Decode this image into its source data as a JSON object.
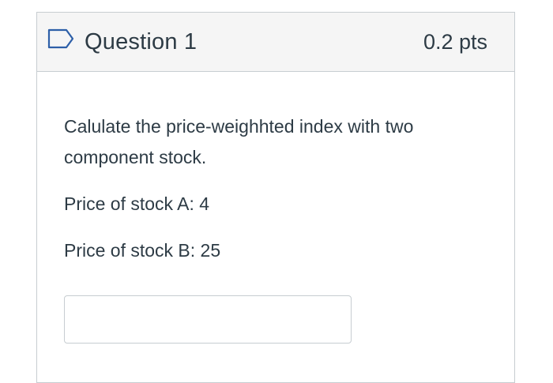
{
  "question": {
    "title": "Question 1",
    "points": "0.2 pts",
    "flag_icon": "flag-outline-icon",
    "body": "Calulate the price-weighhted index with two component stock.",
    "line_a": "Price of stock A: 4",
    "line_b": "Price of stock B: 25",
    "answer_value": "",
    "answer_placeholder": ""
  },
  "colors": {
    "header_bg": "#f5f5f5",
    "border": "#c7cdd1",
    "text": "#2d3b45",
    "flag_stroke": "#2d5fa8"
  }
}
